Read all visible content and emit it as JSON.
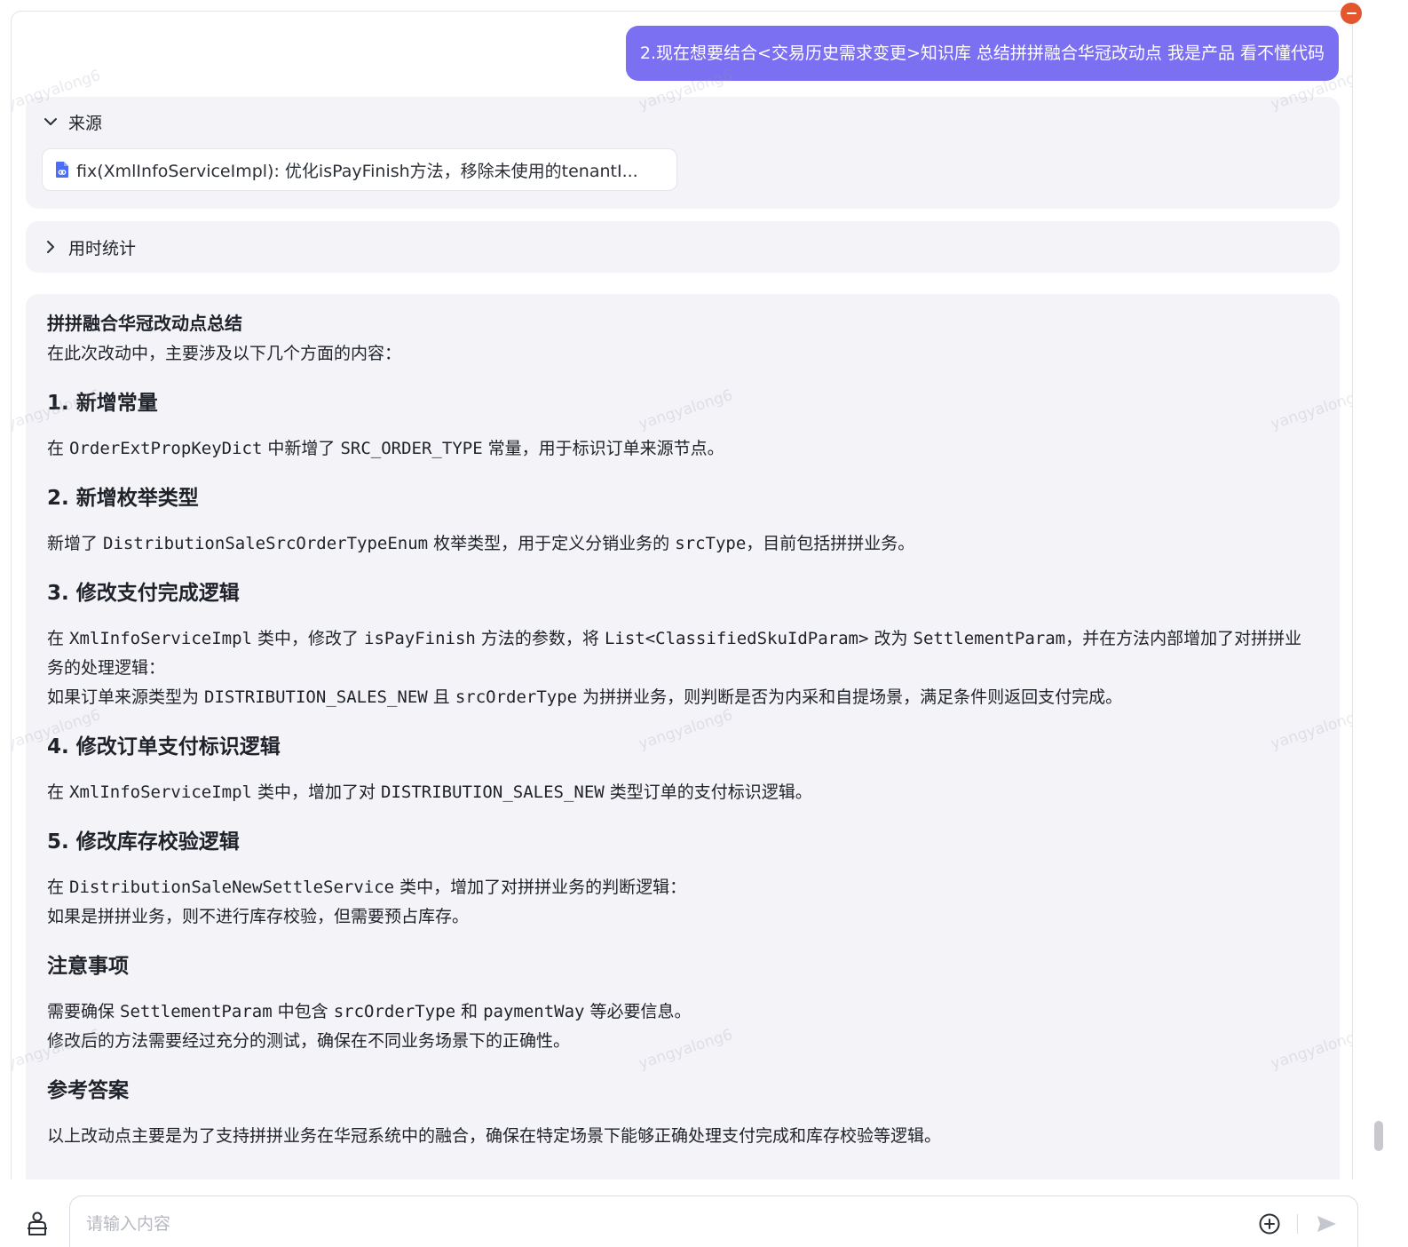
{
  "user_message": "2.现在想要结合<交易历史需求变更>知识库 总结拼拼融合华冠改动点 我是产品 看不懂代码",
  "sources": {
    "label": "来源",
    "items": [
      {
        "text": "fix(XmlInfoServiceImpl): 优化isPayFinish方法，移除未使用的tenantI..."
      }
    ]
  },
  "timing": {
    "label": "用时统计"
  },
  "answer": {
    "title": "拼拼融合华冠改动点总结",
    "intro": "在此次改动中，主要涉及以下几个方面的内容：",
    "sections": [
      {
        "heading": "1. 新增常量",
        "p1_a": "在 ",
        "p1_code1": "OrderExtPropKeyDict",
        "p1_b": " 中新增了 ",
        "p1_code2": "SRC_ORDER_TYPE",
        "p1_c": " 常量，用于标识订单来源节点。"
      },
      {
        "heading": "2. 新增枚举类型",
        "p1_a": "新增了 ",
        "p1_code1": "DistributionSaleSrcOrderTypeEnum",
        "p1_b": " 枚举类型，用于定义分销业务的 ",
        "p1_code2": "srcType",
        "p1_c": "，目前包括拼拼业务。"
      },
      {
        "heading": "3. 修改支付完成逻辑",
        "p1_a": "在 ",
        "p1_code1": "XmlInfoServiceImpl",
        "p1_b": " 类中，修改了 ",
        "p1_code2": "isPayFinish",
        "p1_c": " 方法的参数，将 ",
        "p1_code3": "List<ClassifiedSkuIdParam>",
        "p1_d": " 改为 ",
        "p1_code4": "SettlementParam",
        "p1_e": "，并在方法内部增加了对拼拼业务的处理逻辑：",
        "p2_a": "如果订单来源类型为 ",
        "p2_code1": "DISTRIBUTION_SALES_NEW",
        "p2_b": " 且 ",
        "p2_code2": "srcOrderType",
        "p2_c": " 为拼拼业务，则判断是否为内采和自提场景，满足条件则返回支付完成。"
      },
      {
        "heading": "4. 修改订单支付标识逻辑",
        "p1_a": "在 ",
        "p1_code1": "XmlInfoServiceImpl",
        "p1_b": " 类中，增加了对 ",
        "p1_code2": "DISTRIBUTION_SALES_NEW",
        "p1_c": " 类型订单的支付标识逻辑。"
      },
      {
        "heading": "5. 修改库存校验逻辑",
        "p1_a": "在 ",
        "p1_code1": "DistributionSaleNewSettleService",
        "p1_b": " 类中，增加了对拼拼业务的判断逻辑：",
        "p2": "如果是拼拼业务，则不进行库存校验，但需要预占库存。"
      },
      {
        "heading": "注意事项",
        "p1_a": "需要确保 ",
        "p1_code1": "SettlementParam",
        "p1_b": " 中包含 ",
        "p1_code2": "srcOrderType",
        "p1_c": " 和 ",
        "p1_code3": "paymentWay",
        "p1_d": " 等必要信息。",
        "p2": "修改后的方法需要经过充分的测试，确保在不同业务场景下的正确性。"
      },
      {
        "heading": "参考答案",
        "p1": "以上改动点主要是为了支持拼拼业务在华冠系统中的融合，确保在特定场景下能够正确处理支付完成和库存校验等逻辑。"
      }
    ]
  },
  "input": {
    "placeholder": "请输入内容"
  },
  "watermark": "yangyalong6",
  "colors": {
    "user_bubble": "#7b6ff2",
    "panel_bg": "#f3f3f8",
    "close_dot": "#e4572e"
  },
  "icons": [
    "chevron-down-icon",
    "chevron-right-icon",
    "document-link-icon",
    "close-icon",
    "plus-circle-icon",
    "send-icon",
    "agent-icon"
  ]
}
